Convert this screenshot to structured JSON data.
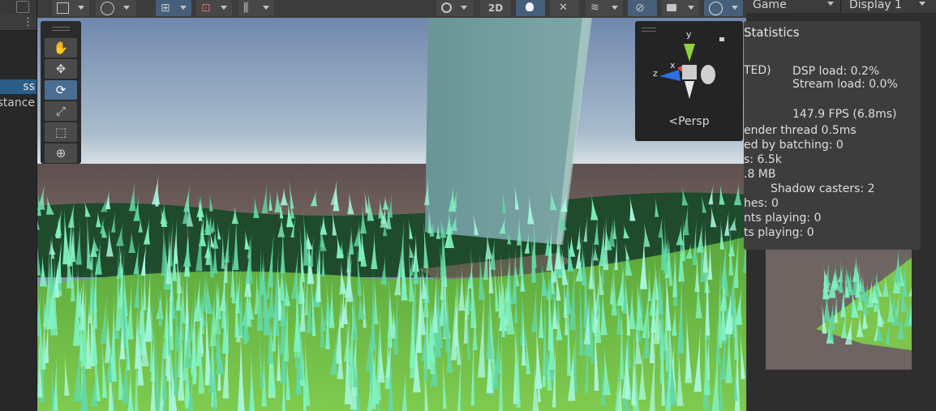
{
  "left_panel": {
    "items": [
      {
        "label": "ss"
      },
      {
        "label": "stance"
      }
    ]
  },
  "scene_toolbar": {
    "mode_2d_label": "2D"
  },
  "tool_palette": {
    "tools": [
      {
        "name": "hand",
        "glyph": "✋"
      },
      {
        "name": "move",
        "glyph": "✥"
      },
      {
        "name": "rotate",
        "glyph": "⟳"
      },
      {
        "name": "scale",
        "glyph": "⤢"
      },
      {
        "name": "rect",
        "glyph": "⬚"
      },
      {
        "name": "transform",
        "glyph": "⊕"
      }
    ],
    "active_tool": "rotate"
  },
  "gizmo": {
    "axis_y": "y",
    "axis_x": "x",
    "axis_z": "z",
    "projection_label": "Persp",
    "colors": {
      "y": "#8fd13f",
      "x": "#e04a3a",
      "z": "#2f6fe0"
    }
  },
  "game_toolbar": {
    "view_label": "Game",
    "display_label": "Display 1"
  },
  "statistics": {
    "title": "Statistics",
    "audio_status_fragment": "TED)",
    "dsp_load": "DSP load: 0.2%",
    "stream_load": "Stream load: 0.0%",
    "fps": "147.9 FPS (6.8ms)",
    "render_thread": "ender thread 0.5ms",
    "saved_by_batching": "ed by batching: 0",
    "tris": "s: 6.5k",
    "memory": ".8 MB",
    "shadow_casters": "Shadow casters: 2",
    "skinned_meshes": "hes: 0",
    "animations_playing": "nts playing: 0",
    "animators_playing": "ts playing: 0"
  },
  "colors": {
    "selection": "#2c5d87",
    "active_tool": "#4a6d91",
    "grass_light": "#7ff2c0",
    "ground": "#76c448",
    "sky_top": "#6f88ad"
  }
}
